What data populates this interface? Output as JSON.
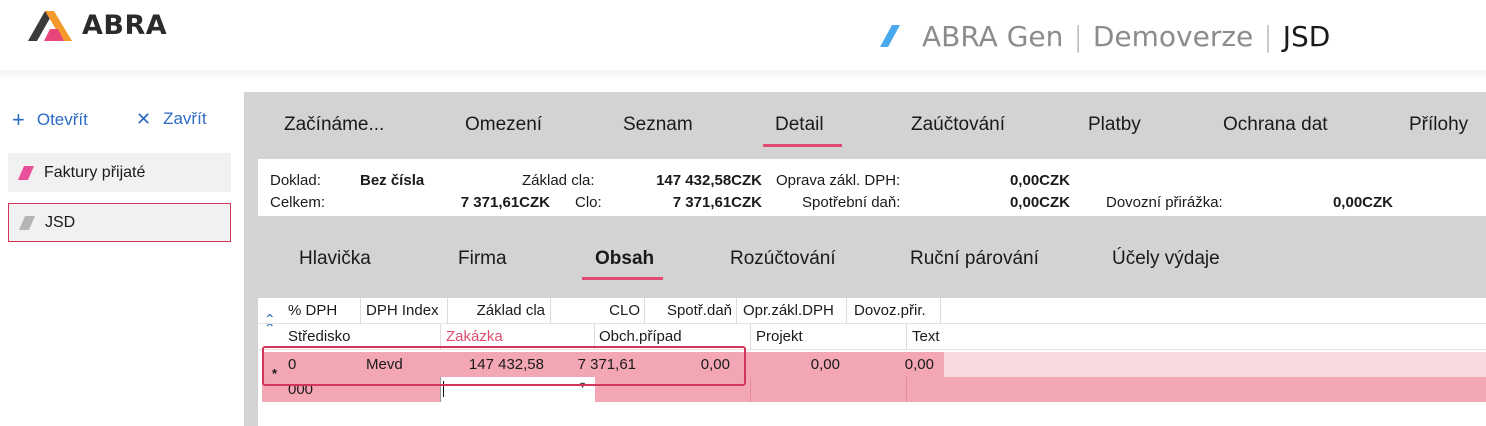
{
  "header": {
    "logo_text": "ABRA",
    "brand_parts": [
      "ABRA Gen",
      "Demoverze",
      "JSD"
    ],
    "brand_separator": "|"
  },
  "left_panel": {
    "open_label": "Otevřít",
    "close_label": "Zavřít",
    "items": [
      {
        "label": "Faktury přijaté",
        "color": "#e8519a"
      },
      {
        "label": "JSD",
        "color": "#b5b5b5"
      }
    ]
  },
  "main_tabs": {
    "items": [
      "Začínáme...",
      "Omezení",
      "Seznam",
      "Detail",
      "Zaúčtování",
      "Platby",
      "Ochrana dat",
      "Přílohy"
    ],
    "active": "Detail"
  },
  "summary": {
    "doklad_label": "Doklad:",
    "doklad_value": "Bez čísla",
    "celkem_label": "Celkem:",
    "celkem_value": "7 371,61CZK",
    "zaklad_cla_label": "Základ cla:",
    "zaklad_cla_value": "147 432,58CZK",
    "clo_label": "Clo:",
    "clo_value": "7 371,61CZK",
    "oprava_label": "Oprava zákl. DPH:",
    "oprava_value": "0,00CZK",
    "spotrebni_label": "Spotřební daň:",
    "spotrebni_value": "0,00CZK",
    "dovozni_label": "Dovozní přirážka:",
    "dovozni_value": "0,00CZK"
  },
  "sub_tabs": {
    "items": [
      "Hlavička",
      "Firma",
      "Obsah",
      "Rozúčtování",
      "Ruční párování",
      "Účely výdaje"
    ],
    "active": "Obsah"
  },
  "grid": {
    "header_row1": [
      "% DPH",
      "DPH Index",
      "Základ cla",
      "CLO",
      "Spotř.daň",
      "Opr.zákl.DPH",
      "Dovoz.přir."
    ],
    "header_row2": [
      "Středisko",
      "Zakázka",
      "Obch.případ",
      "Projekt",
      "Text"
    ],
    "zakazka_color": "#e04d70",
    "row1": [
      "0",
      "Mevd",
      "147 432,58",
      "7 371,61",
      "0,00",
      "0,00",
      "0,00"
    ],
    "row2_stredisko": "000",
    "new_row_marker": "*"
  },
  "colors": {
    "accent": "#e04d70",
    "link": "#2d6bc4",
    "row_highlight": "#f3a6b4"
  }
}
